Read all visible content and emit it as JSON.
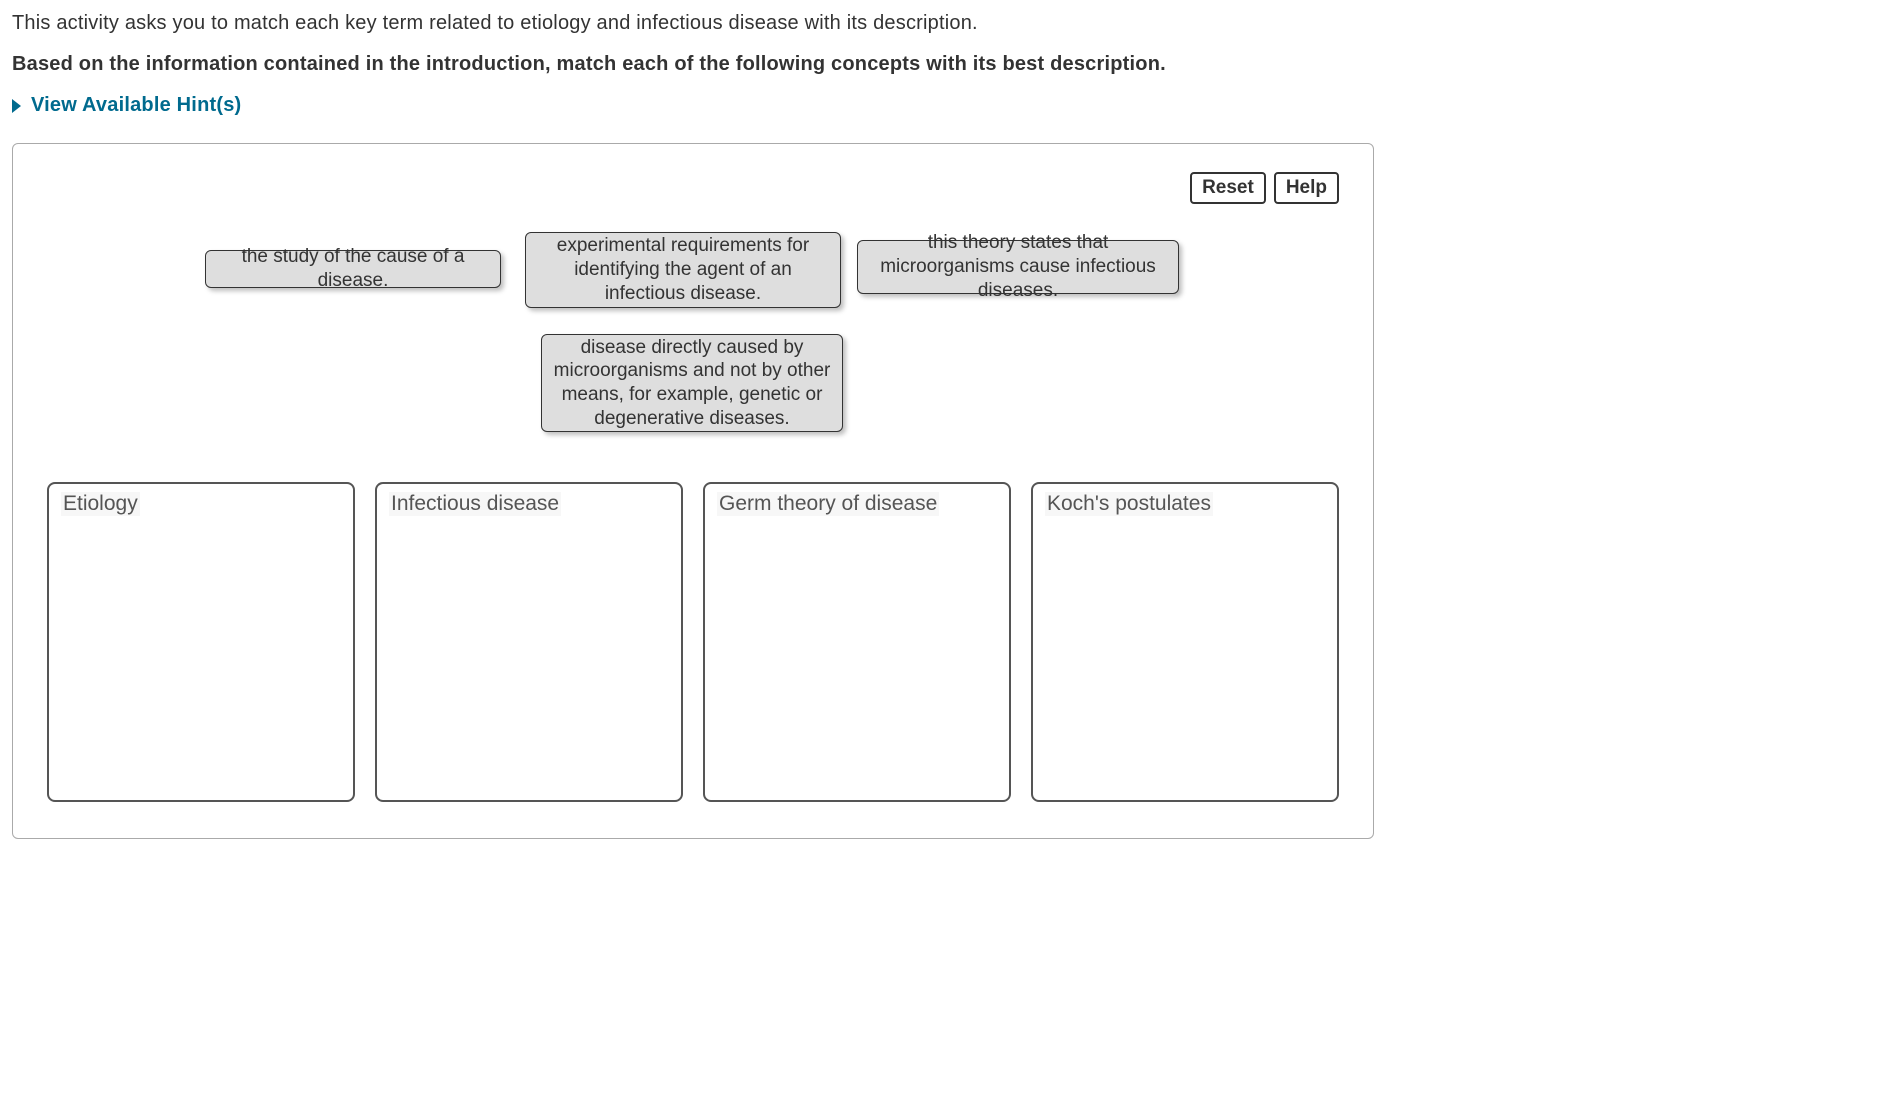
{
  "intro": "This activity asks you to match each key term related to etiology and infectious disease with its description.",
  "prompt": "Based on the information contained in the introduction, match each of the following concepts with its best description.",
  "hints_link": "View Available Hint(s)",
  "buttons": {
    "reset": "Reset",
    "help": "Help"
  },
  "draggables": {
    "d1": "the study of the cause of a disease.",
    "d2": "experimental requirements for identifying the agent of an infectious disease.",
    "d3": "this theory states that microorganisms cause infectious diseases.",
    "d4": "disease directly caused by microorganisms and not by other means, for example, genetic or degenerative diseases."
  },
  "dropzones": {
    "z1": "Etiology",
    "z2": "Infectious disease",
    "z3": "Germ theory of disease",
    "z4": "Koch's postulates"
  }
}
